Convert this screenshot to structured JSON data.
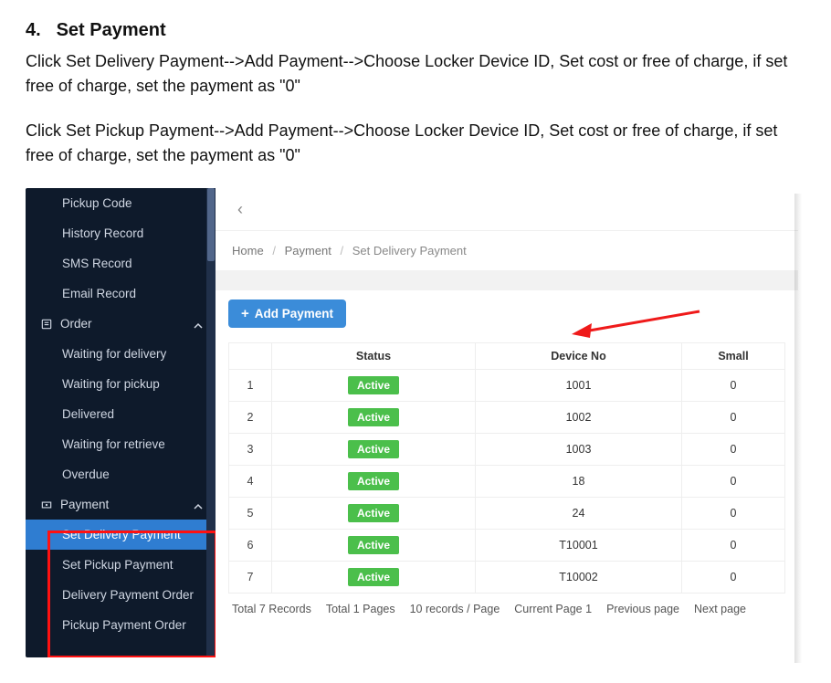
{
  "doc": {
    "heading_num": "4.",
    "heading_text": "Set Payment",
    "para1": "Click Set Delivery Payment-->Add Payment-->Choose Locker Device ID, Set cost or free of charge, if set free of charge, set the payment as \"0\"",
    "para2": "Click Set Pickup Payment-->Add Payment-->Choose Locker Device ID, Set cost or free of charge, if set free of charge, set the payment as \"0\""
  },
  "sidebar": {
    "top_items": [
      "Pickup Code",
      "History Record",
      "SMS Record",
      "Email Record"
    ],
    "sections": [
      {
        "label": "Order",
        "items": [
          "Waiting for delivery",
          "Waiting for pickup",
          "Delivered",
          "Waiting for retrieve",
          "Overdue"
        ]
      },
      {
        "label": "Payment",
        "items": [
          "Set Delivery Payment",
          "Set Pickup Payment",
          "Delivery Payment Order",
          "Pickup Payment Order"
        ],
        "active_index": 0
      }
    ]
  },
  "main": {
    "toggle_glyph": "‹",
    "breadcrumbs": [
      "Home",
      "Payment",
      "Set Delivery Payment"
    ],
    "add_button": "Add Payment",
    "table": {
      "headers": [
        "",
        "Status",
        "Device No",
        "Small"
      ],
      "status_label": "Active",
      "rows": [
        {
          "idx": "1",
          "device": "1001",
          "small": "0"
        },
        {
          "idx": "2",
          "device": "1002",
          "small": "0"
        },
        {
          "idx": "3",
          "device": "1003",
          "small": "0"
        },
        {
          "idx": "4",
          "device": "18",
          "small": "0"
        },
        {
          "idx": "5",
          "device": "24",
          "small": "0"
        },
        {
          "idx": "6",
          "device": "T10001",
          "small": "0"
        },
        {
          "idx": "7",
          "device": "T10002",
          "small": "0"
        }
      ]
    },
    "pager": {
      "total_records": "Total 7 Records",
      "total_pages": "Total 1 Pages",
      "per_page": "10 records / Page",
      "current": "Current Page 1",
      "prev": "Previous page",
      "next": "Next page"
    }
  }
}
